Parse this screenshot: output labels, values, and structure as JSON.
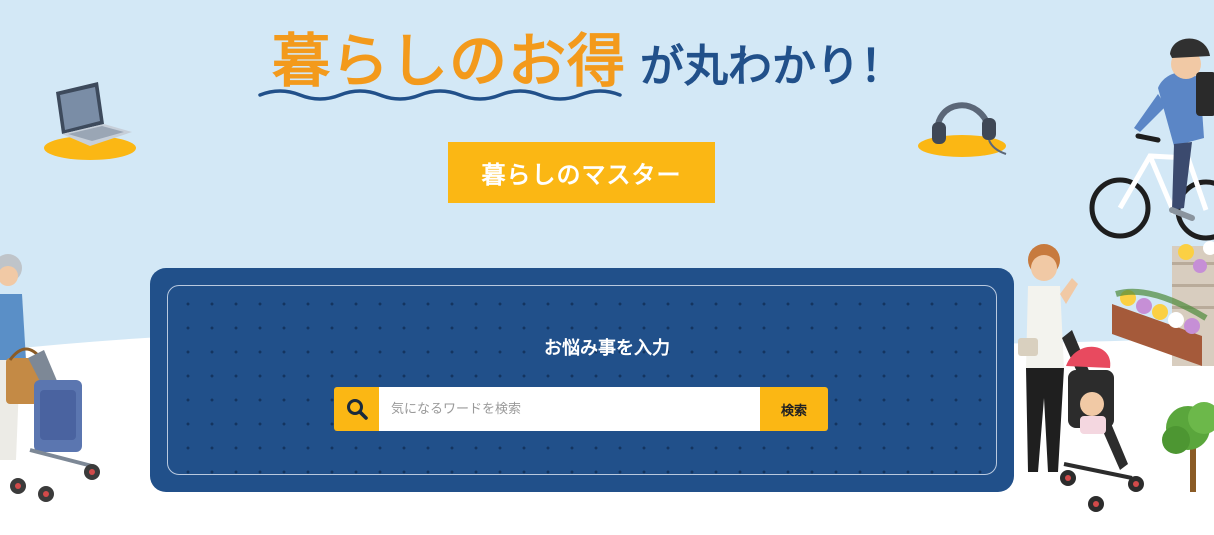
{
  "hero": {
    "title_accent": "暮らしのお得",
    "title_rest": "が丸わかり！",
    "badge": "暮らしのマスター"
  },
  "search": {
    "heading": "お悩み事を入力",
    "placeholder": "気になるワードを検索",
    "value": "",
    "button_label": "検索"
  },
  "colors": {
    "sky": "#d3e8f6",
    "accent_orange": "#f39a1c",
    "brand_yellow": "#fbb714",
    "navy": "#21508a"
  },
  "icons": {
    "search": "magnifier-icon",
    "laptop": "laptop-icon",
    "headphones": "headphones-icon"
  }
}
